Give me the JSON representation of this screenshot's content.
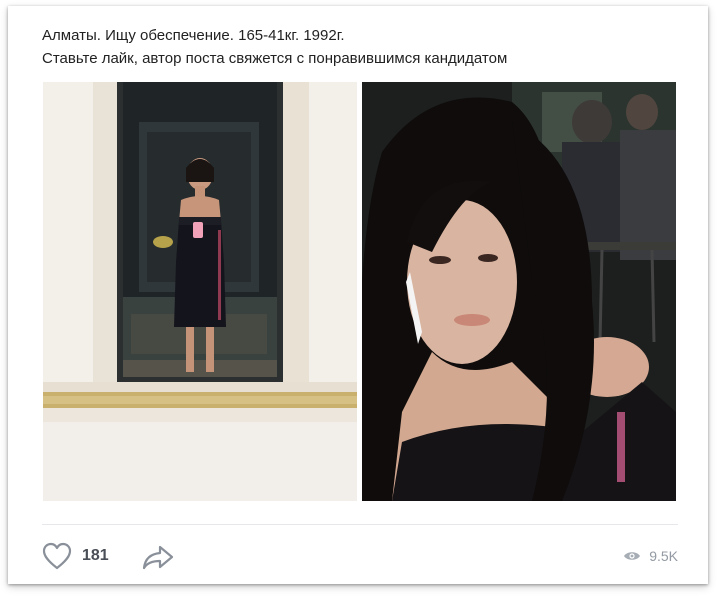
{
  "post": {
    "text_line1": "Алматы. Ищу обеспечение. 165-41кг. 1992г.",
    "text_line2": "Ставьте лайк, автор поста свяжется с понравившимся кандидатом"
  },
  "photos": [
    {
      "description": "mirror-selfie"
    },
    {
      "description": "portrait-selfie"
    }
  ],
  "footer": {
    "likes_count": "181",
    "views_count": "9.5K",
    "like_icon": "heart-outline-icon",
    "share_icon": "share-arrow-icon",
    "views_icon": "eye-icon"
  },
  "colors": {
    "icon_gray": "#8a9099",
    "text": "#222222",
    "muted": "#939aa3"
  }
}
